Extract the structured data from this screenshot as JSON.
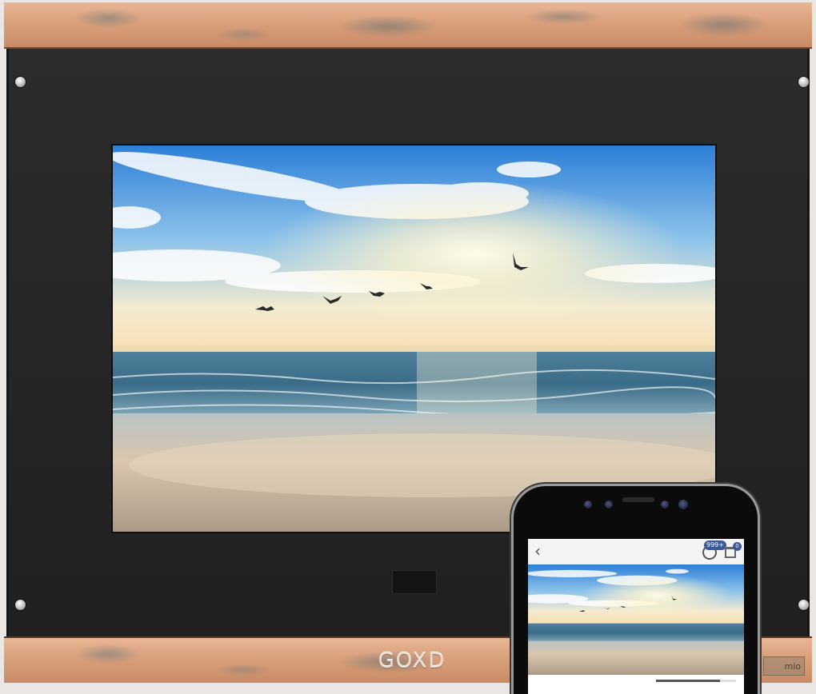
{
  "device": {
    "brand_logo": "GOXD",
    "corner_stamp": "mio"
  },
  "photo": {
    "subject": "seaside sunrise with seagulls over the beach"
  },
  "phone_app": {
    "back_icon": "chevron-left-icon",
    "rating_badge": "999+",
    "rating_icon": "rating-icon",
    "cart_icon": "cart-icon",
    "cart_badge": "0",
    "progress": 0.8
  },
  "colors": {
    "copper": "#d9a07c",
    "bezel": "#232323",
    "sky_top": "#2f7fd6",
    "sun": "#fff6d8",
    "sea": "#3d6f8e",
    "sand": "#c9b7a2",
    "badge": "#3a5a9a"
  }
}
